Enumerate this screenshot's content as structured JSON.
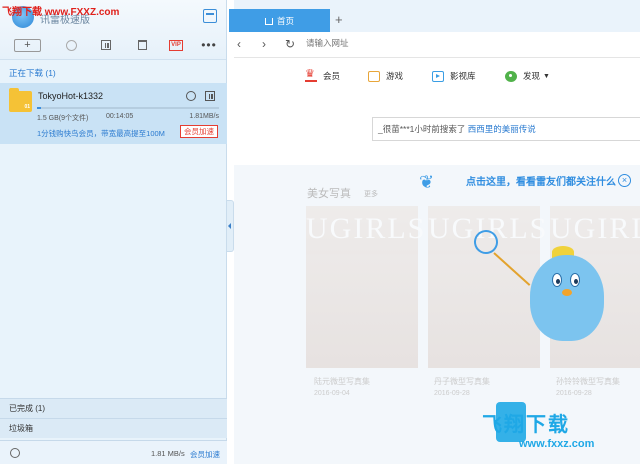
{
  "watermark": "飞翔下载 www.FXXZ.com",
  "app": {
    "name": "讯雷极速版"
  },
  "toolbar": {
    "new_label": "+",
    "vip_label": "VIP",
    "more_label": "•••"
  },
  "left": {
    "downloading_label": "正在下载 (1)",
    "task": {
      "name": "TokyoHot-k1332",
      "folder_badge": "01",
      "size": "1.5 GB(9个文件)",
      "time": "00:14:05",
      "speed": "1.81MB/s",
      "progress": 0.02,
      "promo": "1分钱购快鸟会员，带宽最高提至100M",
      "accel_label": "会员加速"
    },
    "completed_label": "已完成 (1)",
    "trash_label": "垃圾箱",
    "status": {
      "speed": "1.81 MB/s",
      "accel_label": "会员加速"
    }
  },
  "browser": {
    "tab_home": "首页",
    "tab_add": "+",
    "url_placeholder": "请输入网址",
    "quicknav": {
      "member": "会员",
      "game": "游戏",
      "video": "影视库",
      "discover": "发现"
    },
    "search": {
      "prefix": "_很苗***1小时前搜索了 ",
      "hot": "西西里的美丽传说"
    },
    "bird_text": "点击这里，看看雷友们都关注什么",
    "gallery": {
      "title": "美女写真",
      "more": "更多",
      "brand": "UGIRLS",
      "items": [
        {
          "caption": "陆元微型写真集",
          "date": "2016-09-04"
        },
        {
          "caption": "丹子微型写真集",
          "date": "2016-09-28"
        },
        {
          "caption": "孙铃铃微型写真集",
          "date": "2016-09-28"
        }
      ]
    },
    "watermark_logo": "飞翔下载",
    "watermark_url": "www.fxxz.com"
  },
  "colors": {
    "accent": "#3f9de6",
    "link": "#2b7bd0",
    "danger": "#e53d32",
    "panel": "#e8f3fb",
    "selected": "#c9e2f5"
  }
}
